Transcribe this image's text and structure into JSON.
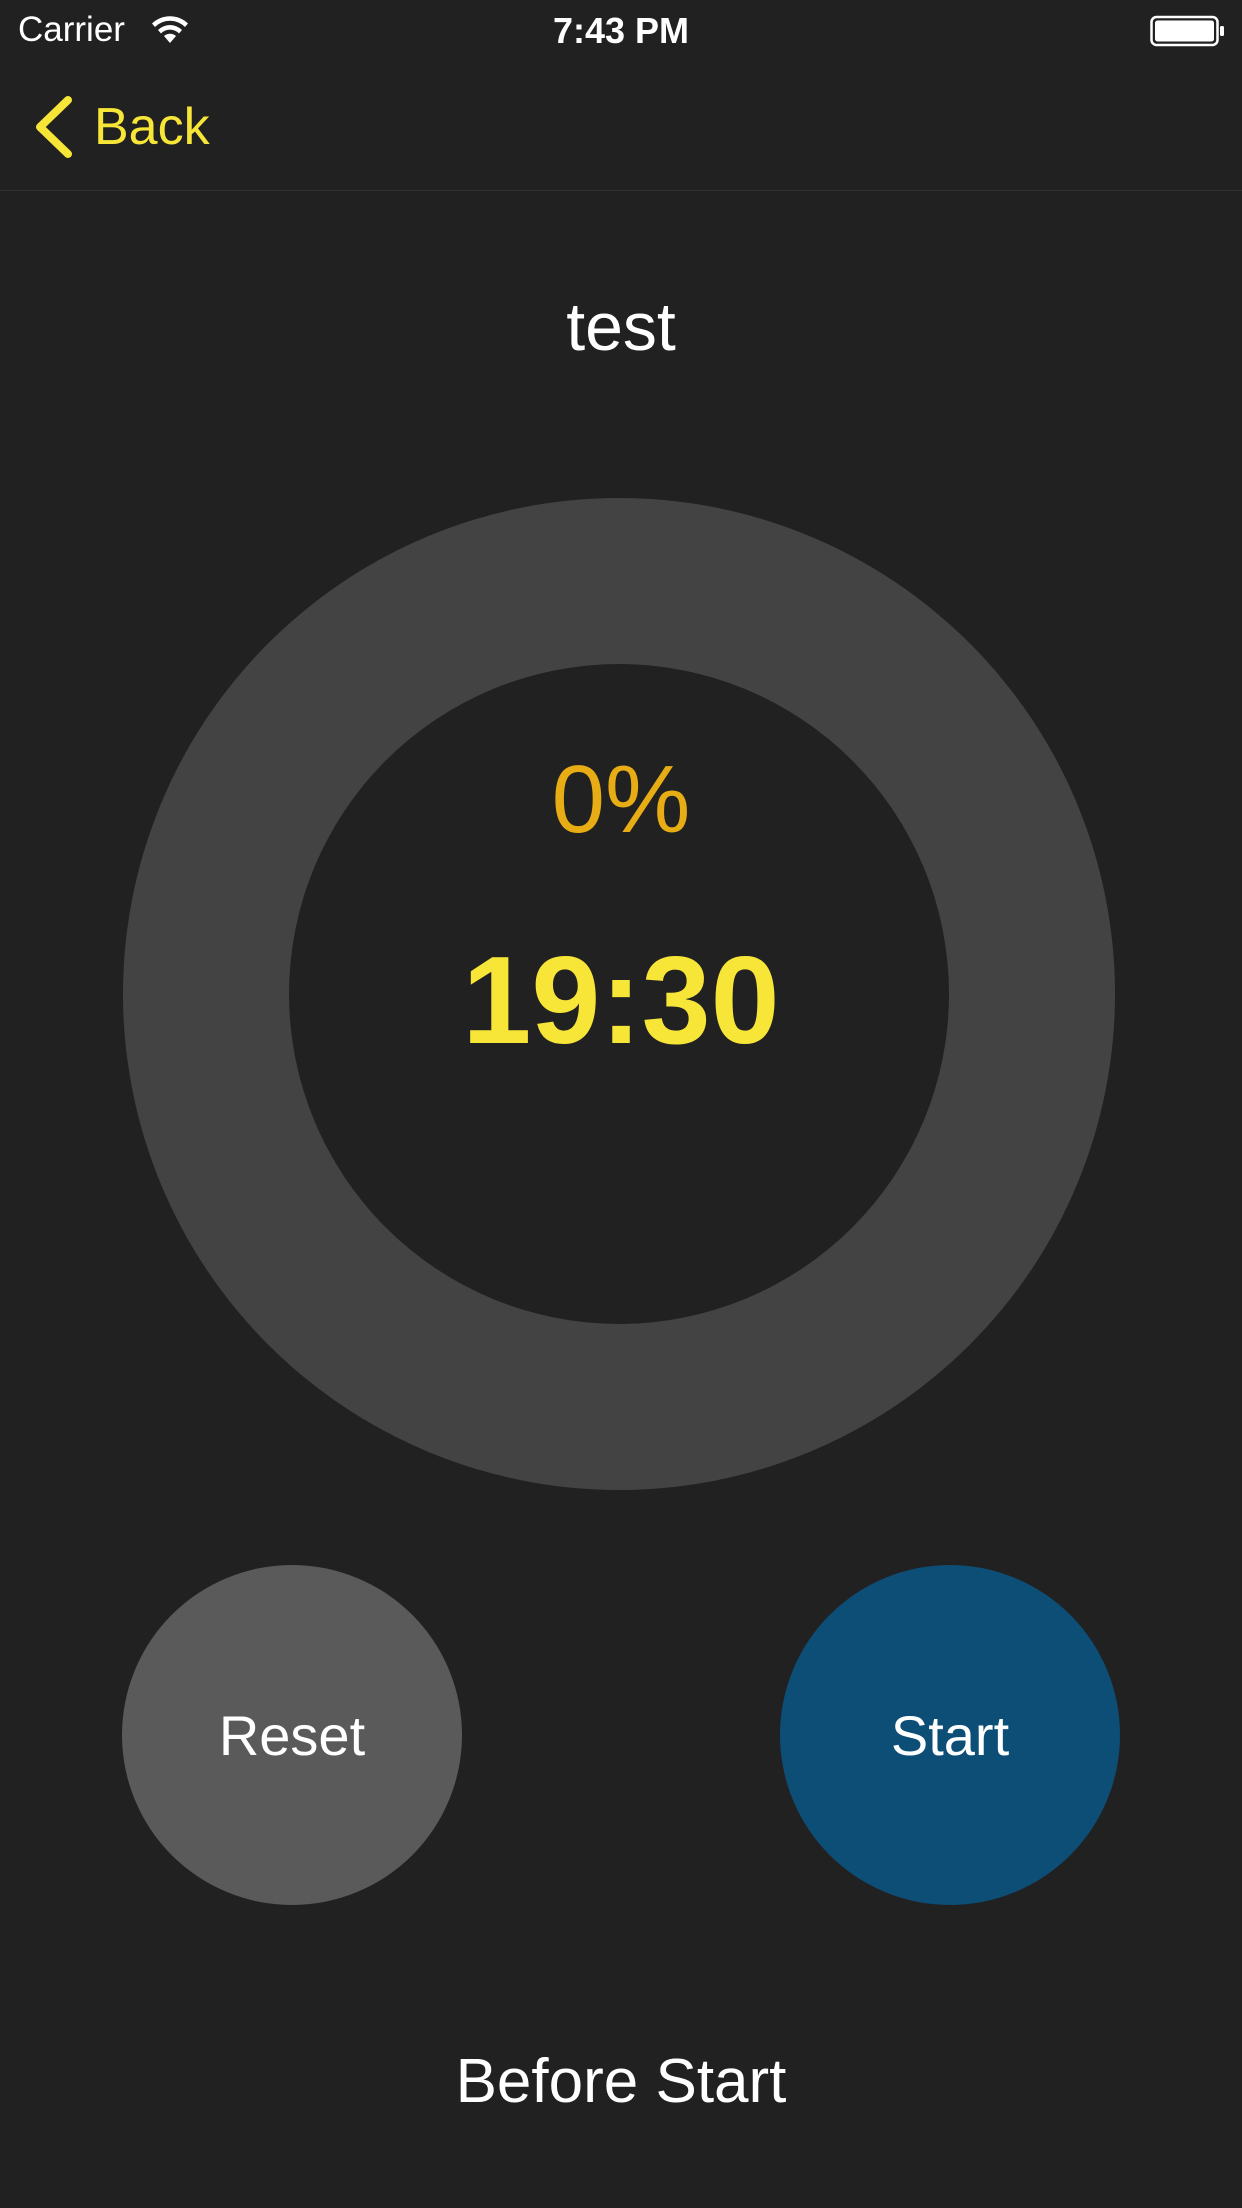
{
  "status_bar": {
    "carrier": "Carrier",
    "time": "7:43 PM",
    "wifi_icon": "wifi-icon",
    "battery_icon": "battery-full-icon"
  },
  "nav": {
    "back_label": "Back",
    "back_icon": "chevron-left-icon"
  },
  "timer": {
    "title": "test",
    "progress_percent": "0%",
    "progress_value": 0,
    "remaining": "19:30",
    "state": "Before Start"
  },
  "controls": {
    "reset_label": "Reset",
    "start_label": "Start"
  },
  "colors": {
    "background": "#212121",
    "accent_yellow": "#f7e538",
    "percent_orange": "#e8ad14",
    "ring_track": "#434343",
    "reset_gray": "#5a5a5a",
    "start_blue": "#0d4e77"
  }
}
